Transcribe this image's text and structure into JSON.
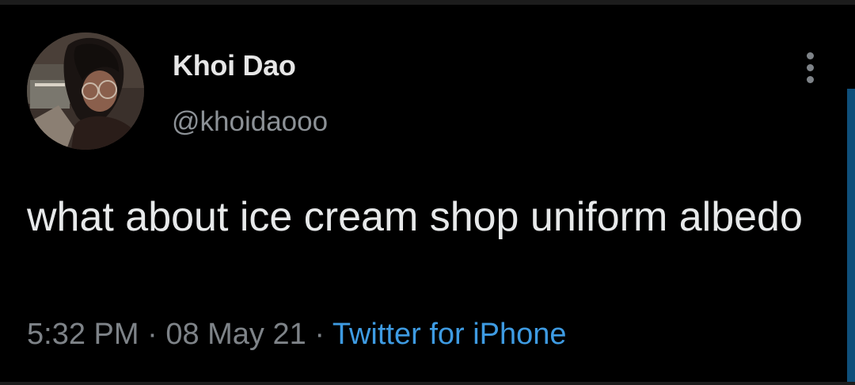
{
  "tweet": {
    "author": {
      "display_name": "Khoi Dao",
      "handle": "@khoidaooo",
      "avatar": "profile-photo"
    },
    "text": "what about ice cream shop uniform albedo",
    "time": "5:32 PM",
    "separator": "·",
    "date": "08 May 21",
    "source": "Twitter for iPhone",
    "menu_icon": "more-vertical-icon"
  },
  "colors": {
    "background": "#000000",
    "text_primary": "#e7e9ea",
    "text_secondary": "#7e8388",
    "link": "#3e9be2"
  }
}
